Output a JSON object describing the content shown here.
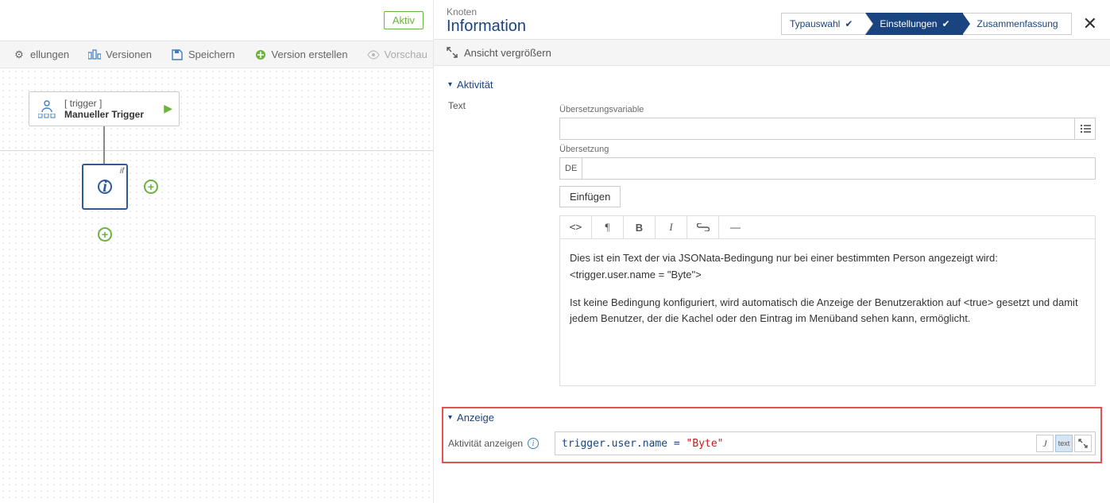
{
  "status": {
    "active_label": "Aktiv"
  },
  "toolbar": {
    "settings": "ellungen",
    "versions": "Versionen",
    "save": "Speichern",
    "create_version": "Version erstellen",
    "preview": "Vorschau"
  },
  "canvas": {
    "trigger_tag": "[ trigger ]",
    "trigger_title": "Manueller Trigger",
    "info_if": "if"
  },
  "header": {
    "breadcrumb": "Knoten",
    "title": "Information"
  },
  "wizard": {
    "step1": "Typauswahl",
    "step2": "Einstellungen",
    "step3": "Zusammenfassung"
  },
  "expand": {
    "label": "Ansicht vergrößern"
  },
  "section_activity": {
    "title": "Aktivität"
  },
  "form": {
    "side_label": "Text",
    "var_label": "Übersetzungsvariable",
    "trans_label": "Übersetzung",
    "lang_code": "DE",
    "insert_btn": "Einfügen",
    "editor_l1": "Dies ist ein Text der via JSONata-Bedingung nur bei einer bestimmten Person angezeigt wird:",
    "editor_l2": "<trigger.user.name = \"Byte\">",
    "editor_l3": "Ist keine Bedingung konfiguriert, wird automatisch die Anzeige der Benutzeraktion auf <true> gesetzt und damit jedem Benutzer, der die Kachel oder den Eintrag im Menüband sehen kann, ermöglicht."
  },
  "section_display": {
    "title": "Anzeige",
    "show_label": "Aktivität anzeigen"
  },
  "code": {
    "prefix": "trigger.user.name = ",
    "string": "\"Byte\"",
    "btn_text": "text"
  }
}
